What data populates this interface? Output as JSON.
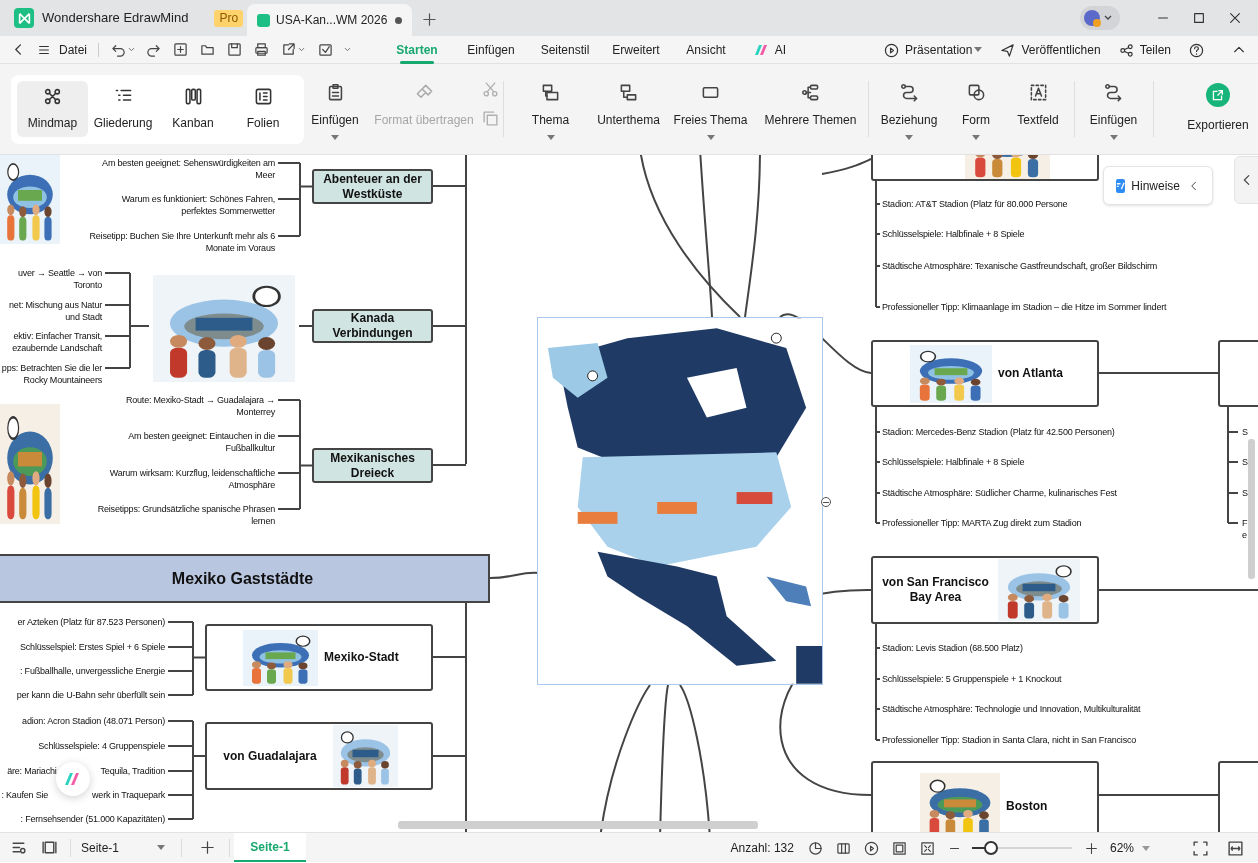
{
  "app_tab": {
    "title": "Wondershare EdrawMind",
    "badge": "Pro"
  },
  "document_tab": {
    "title": "USA-Kan...WM 2026",
    "unsaved": true
  },
  "menu": {
    "file": "Datei"
  },
  "ribbon_tabs": [
    {
      "label": "Starten",
      "selected": true,
      "kind": "text"
    },
    {
      "label": "Einfügen",
      "selected": false,
      "kind": "text"
    },
    {
      "label": "Seitenstil",
      "selected": false,
      "kind": "text"
    },
    {
      "label": "Erweitert",
      "selected": false,
      "kind": "text"
    },
    {
      "label": "Ansicht",
      "selected": false,
      "kind": "text"
    },
    {
      "label": "AI",
      "selected": false,
      "kind": "ai"
    }
  ],
  "actions": [
    {
      "label": "Präsentation",
      "kind": "play",
      "dropdown": true
    },
    {
      "label": "Veröffentlichen",
      "kind": "send",
      "dropdown": false
    },
    {
      "label": "Teilen",
      "kind": "share",
      "dropdown": false
    }
  ],
  "view_modes": [
    {
      "label": "Mindmap",
      "selected": true,
      "kind": "mindmap"
    },
    {
      "label": "Gliederung",
      "selected": false,
      "kind": "outline"
    },
    {
      "label": "Kanban",
      "selected": false,
      "kind": "kanban"
    },
    {
      "label": "Folien",
      "selected": false,
      "kind": "slides"
    }
  ],
  "tools": [
    {
      "label": "Einfügen",
      "kind": "paste",
      "disabled": false,
      "dropdown": true
    },
    {
      "label": "Format übertragen",
      "kind": "brush",
      "disabled": true,
      "dropdown": false
    },
    {
      "label": "Thema",
      "kind": "topic",
      "disabled": false,
      "dropdown": true
    },
    {
      "label": "Unterthema",
      "kind": "subtopic",
      "disabled": false,
      "dropdown": false
    },
    {
      "label": "Freies Thema",
      "kind": "free",
      "disabled": false,
      "dropdown": true
    },
    {
      "label": "Mehrere Themen",
      "kind": "multi",
      "disabled": false,
      "dropdown": false
    },
    {
      "label": "Beziehung",
      "kind": "relation",
      "disabled": false,
      "dropdown": true
    },
    {
      "label": "Form",
      "kind": "shape",
      "disabled": false,
      "dropdown": true
    },
    {
      "label": "Textfeld",
      "kind": "textbox",
      "disabled": false,
      "dropdown": false
    },
    {
      "label": "Einfügen",
      "kind": "relation",
      "disabled": false,
      "dropdown": true
    },
    {
      "label": "Exportieren",
      "kind": "export",
      "disabled": false,
      "dropdown": false
    }
  ],
  "hints": "Hinweise",
  "canvas": {
    "main_topic": "Mexiko Gaststädte",
    "topics": [
      {
        "title": "Abenteuer an der Westküste",
        "kind": "group",
        "details": [
          [
            "Am besten geeignet: Sehenswürdigkeiten am Meer"
          ],
          [
            "Warum es funktioniert: Schönes Fahren, perfektes Sommerwetter"
          ],
          [
            "Reisetipp: Buchen Sie Ihre Unterkunft mehr als 6 Monate im Voraus"
          ]
        ]
      },
      {
        "title": "Kanada Verbindungen",
        "kind": "group",
        "details": [
          [
            "uver → Seattle → von Toronto"
          ],
          [
            "net: Mischung aus Natur und Stadt"
          ],
          [
            "ektiv: Einfacher Transit, ezaubernde Landschaft"
          ],
          [
            "pps: Betrachten Sie die ler Rocky Mountaineers"
          ]
        ]
      },
      {
        "title": "Mexikanisches Dreieck",
        "kind": "group",
        "details": [
          [
            "Route: Mexiko-Stadt → Guadalajara → Monterrey"
          ],
          [
            "Am besten geeignet: Eintauchen in die Fußballkultur"
          ],
          [
            "Warum wirksam: Kurzflug, leidenschaftliche Atmosphäre"
          ],
          [
            "Reisetipps: Grundsätzliche spanische Phrasen lernen"
          ]
        ]
      },
      {
        "title": "Mexiko-Stadt",
        "kind": "city",
        "details": [
          [
            "er Azteken (Platz für 87.523 Personen)"
          ],
          [
            "Schlüsselspiel: Erstes Spiel + 6 Spiele"
          ],
          [
            ": Fußballhalle, unvergessliche Energie"
          ],
          [
            "per kann die U-Bahn sehr überfüllt sein"
          ]
        ]
      },
      {
        "title": "von Guadalajara",
        "kind": "city",
        "details": [
          [
            "adion: Acron Stadion (48.071 Person)"
          ],
          [
            "Schlüsselspiele: 4 Gruppenspiele"
          ],
          [
            "äre: Mariachi",
            "Tequila, Tradition"
          ],
          [
            ": Kaufen Sie",
            "werk in Traquepark"
          ],
          [
            ": Fernsehsender (51.000 Kapazitäten)"
          ]
        ]
      },
      {
        "kind": "city",
        "details": [
          [
            "Stadion: AT&T Stadion (Platz für 80.000 Persone"
          ],
          [
            "Schlüsselspiele: Halbfinale + 8 Spiele"
          ],
          [
            "Städtische Atmosphäre: Texanische Gastfreundschaft, großer Bildschirm"
          ],
          [
            "Professioneller Tipp: Klimaanlage im Stadion – die Hitze im Sommer lindert"
          ]
        ]
      },
      {
        "title": "von Atlanta",
        "kind": "city",
        "details": [
          [
            "Stadion: Mercedes-Benz Stadion (Platz für 42.500 Personen)"
          ],
          [
            "Schlüsselspiele: Halbfinale + 8 Spiele"
          ],
          [
            "Städtische Atmosphäre: Südlicher Charme, kulinarisches Fest"
          ],
          [
            "Professioneller Tipp: MARTA Zug direkt zum Stadion"
          ]
        ]
      },
      {
        "title": "von San Francisco Bay Area",
        "kind": "city",
        "details": [
          [
            "Stadion: Levis Stadion (68.500 Platz)"
          ],
          [
            "Schlüsselspiele: 5 Gruppenspiele + 1 Knockout"
          ],
          [
            "Städtische Atmosphäre: Technologie und Innovation, Multikulturalität"
          ],
          [
            "Professioneller Tipp: Stadion in Santa Clara, nicht in San Francisco"
          ]
        ]
      },
      {
        "title": "Boston",
        "kind": "city"
      }
    ],
    "edge_texts": [
      "S",
      "S",
      "S",
      "F e"
    ]
  },
  "status_bar": {
    "page_select": "Seite-1",
    "page_tab": "Seite-1",
    "count": "Anzahl: 132",
    "zoom": {
      "level": 0.19,
      "reading": "62%"
    }
  }
}
